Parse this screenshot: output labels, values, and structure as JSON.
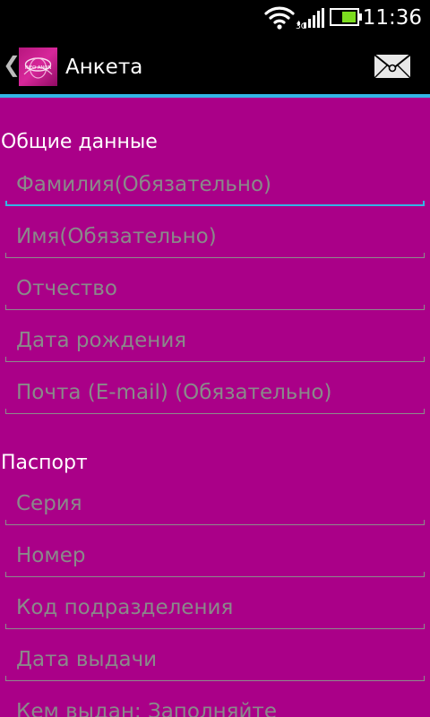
{
  "status_bar": {
    "time": "11:36"
  },
  "action_bar": {
    "title": "Анкета",
    "logo_text": "INFO    ANON"
  },
  "sections": {
    "general": {
      "header": "Общие данные",
      "fields": [
        {
          "placeholder": "Фамилия(Обязательно)",
          "focused": true
        },
        {
          "placeholder": "Имя(Обязательно)"
        },
        {
          "placeholder": "Отчество"
        },
        {
          "placeholder": "Дата рождения"
        },
        {
          "placeholder": "Почта (E-mail) (Обязательно)"
        }
      ]
    },
    "passport": {
      "header": "Паспорт",
      "fields": [
        {
          "placeholder": "Серия"
        },
        {
          "placeholder": "Номер"
        },
        {
          "placeholder": "Код подразделения"
        },
        {
          "placeholder": "Дата выдачи"
        },
        {
          "placeholder": "Кем выдан: Заполняйте"
        }
      ]
    }
  },
  "icons": {
    "back": "chevron-left-icon",
    "logo": "app-logo",
    "mail": "envelope-icon",
    "wifi": "wifi-icon",
    "signal": "signal-icon",
    "battery": "battery-icon"
  },
  "colors": {
    "background": "#aa0088",
    "bar": "#000000",
    "accent": "#33b5e5",
    "hint": "#8a8a8a"
  }
}
